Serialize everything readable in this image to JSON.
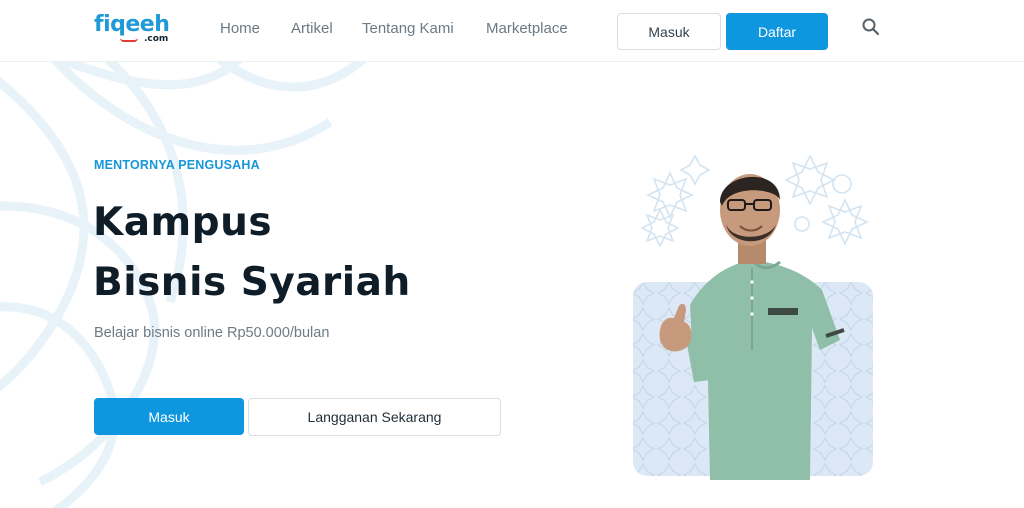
{
  "header": {
    "logo_main": "fiqeeh",
    "logo_sub": ".com",
    "nav": [
      {
        "label": "Home"
      },
      {
        "label": "Artikel"
      },
      {
        "label": "Tentang Kami"
      },
      {
        "label": "Marketplace"
      }
    ],
    "login_label": "Masuk",
    "register_label": "Daftar",
    "search_icon": "search-icon"
  },
  "hero": {
    "eyebrow": "MENTORNYA PENGUSAHA",
    "title_line1": "Kampus",
    "title_line2": "Bisnis Syariah",
    "subtitle": "Belajar bisnis online Rp50.000/bulan",
    "primary_button": "Masuk",
    "secondary_button": "Langganan Sekarang"
  },
  "colors": {
    "brand_blue": "#0e96df",
    "logo_blue": "#1e9ad8",
    "logo_accent": "#e53a2f",
    "heading": "#0e1d27",
    "muted_text": "#6d7b85",
    "ornament": "#e6f1f8"
  }
}
